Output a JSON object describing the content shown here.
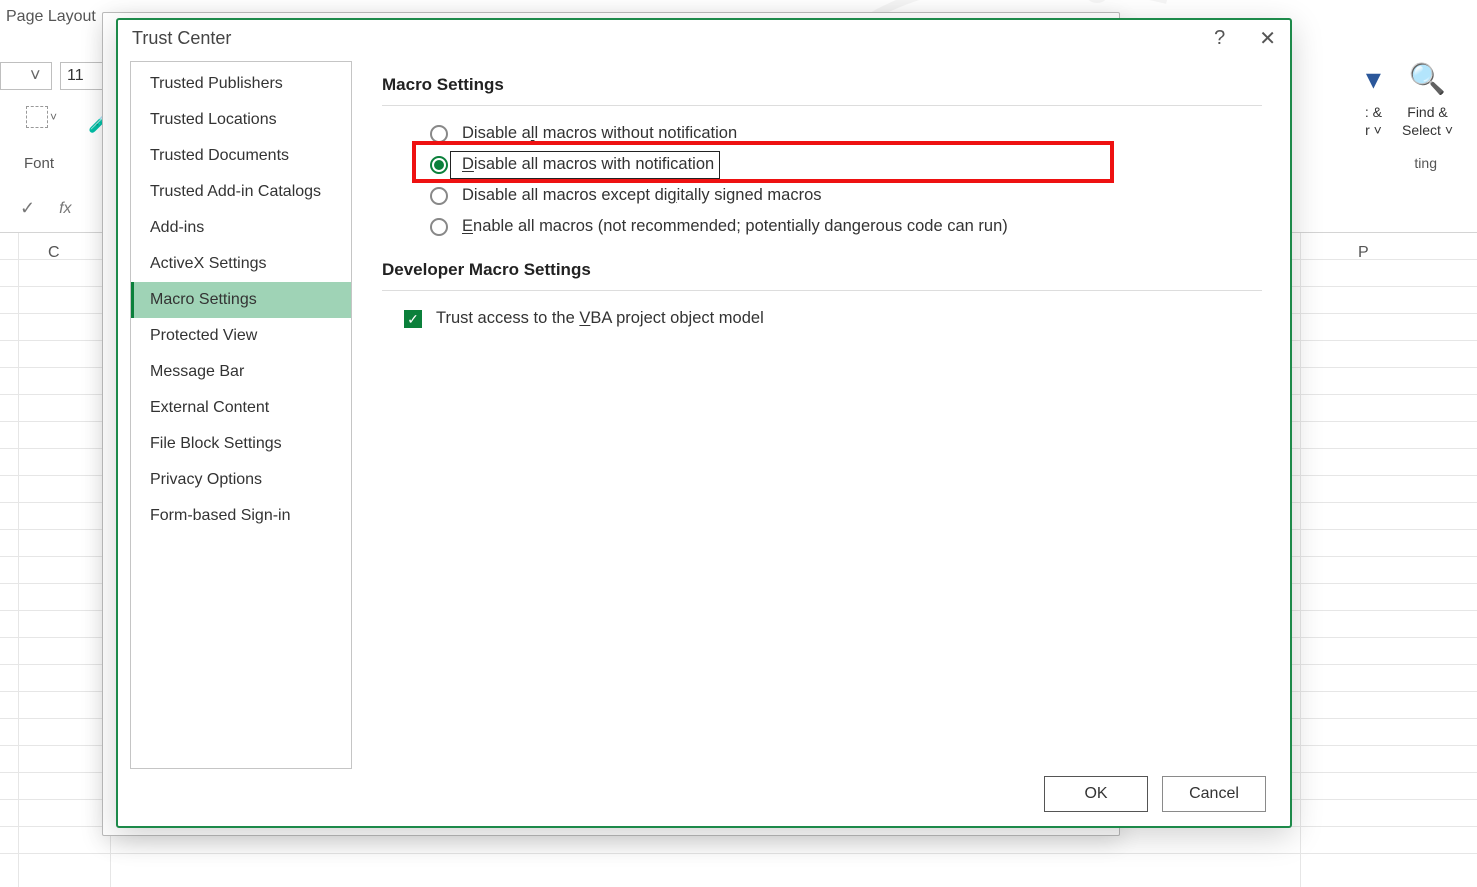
{
  "bg": {
    "tab_page_layout": "Page Layout",
    "font_group": "Font",
    "font_size": "11",
    "col_c": "C",
    "col_p": "P",
    "sort_partial": ": &",
    "filter_partial": "r ˅",
    "find": "Find &",
    "select": "Select ˅",
    "ting": "ting"
  },
  "dialog": {
    "title": "Trust Center",
    "sidebar": {
      "items": [
        {
          "label": "Trusted Publishers"
        },
        {
          "label": "Trusted Locations"
        },
        {
          "label": "Trusted Documents"
        },
        {
          "label": "Trusted Add-in Catalogs"
        },
        {
          "label": "Add-ins"
        },
        {
          "label": "ActiveX Settings"
        },
        {
          "label": "Macro Settings",
          "selected": true
        },
        {
          "label": "Protected View"
        },
        {
          "label": "Message Bar"
        },
        {
          "label": "External Content"
        },
        {
          "label": "File Block Settings"
        },
        {
          "label": "Privacy Options"
        },
        {
          "label": "Form-based Sign-in"
        }
      ]
    },
    "panel": {
      "section1_title": "Macro Settings",
      "radios": [
        {
          "pre": "Disable a",
          "m": "l",
          "post": "l macros without notification"
        },
        {
          "pre": "",
          "m": "D",
          "post": "isable all macros with notification",
          "selected": true,
          "highlight": true
        },
        {
          "pre": "Disable all macros except di",
          "m": "g",
          "post": "itally signed macros"
        },
        {
          "pre": "",
          "m": "E",
          "post": "nable all macros (not recommended; potentially dangerous code can run)"
        }
      ],
      "section2_title": "Developer Macro Settings",
      "check1_pre": "Trust access to the ",
      "check1_m": "V",
      "check1_post": "BA project object model",
      "check1_checked": true
    },
    "buttons": {
      "ok": "OK",
      "cancel": "Cancel"
    }
  }
}
